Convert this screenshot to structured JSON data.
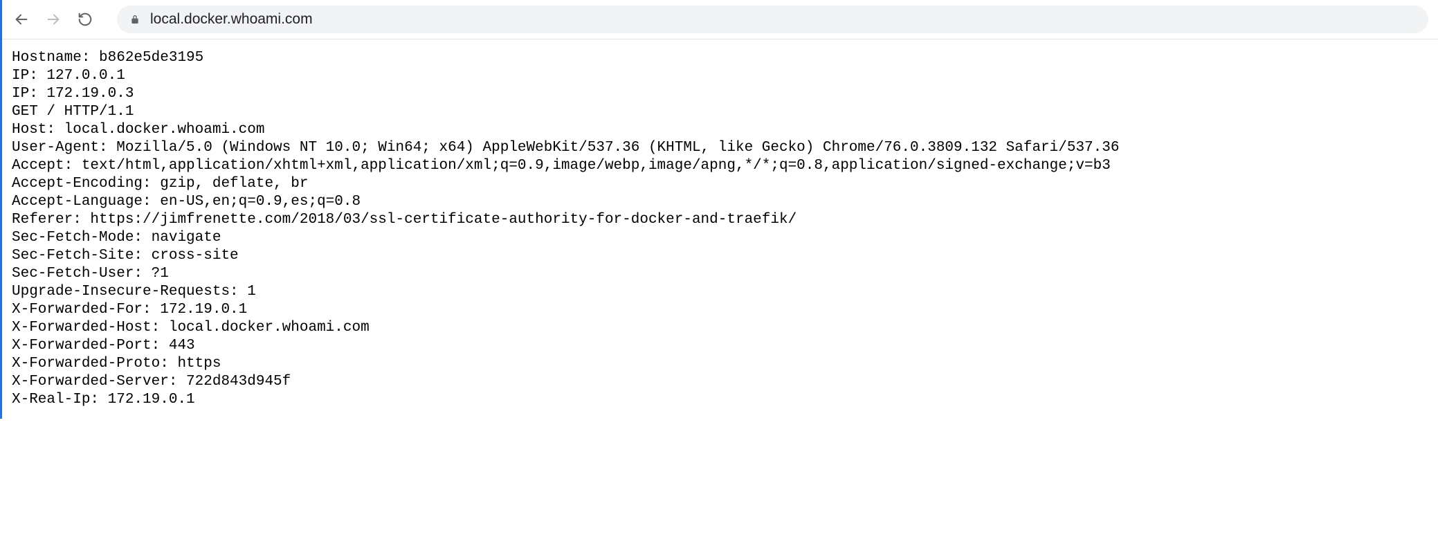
{
  "browser": {
    "url": "local.docker.whoami.com"
  },
  "lines": {
    "l0": "Hostname: b862e5de3195",
    "l1": "IP: 127.0.0.1",
    "l2": "IP: 172.19.0.3",
    "l3": "GET / HTTP/1.1",
    "l4": "Host: local.docker.whoami.com",
    "l5": "User-Agent: Mozilla/5.0 (Windows NT 10.0; Win64; x64) AppleWebKit/537.36 (KHTML, like Gecko) Chrome/76.0.3809.132 Safari/537.36",
    "l6": "Accept: text/html,application/xhtml+xml,application/xml;q=0.9,image/webp,image/apng,*/*;q=0.8,application/signed-exchange;v=b3",
    "l7": "Accept-Encoding: gzip, deflate, br",
    "l8": "Accept-Language: en-US,en;q=0.9,es;q=0.8",
    "l9": "Referer: https://jimfrenette.com/2018/03/ssl-certificate-authority-for-docker-and-traefik/",
    "l10": "Sec-Fetch-Mode: navigate",
    "l11": "Sec-Fetch-Site: cross-site",
    "l12": "Sec-Fetch-User: ?1",
    "l13": "Upgrade-Insecure-Requests: 1",
    "l14": "X-Forwarded-For: 172.19.0.1",
    "l15": "X-Forwarded-Host: local.docker.whoami.com",
    "l16": "X-Forwarded-Port: 443",
    "l17": "X-Forwarded-Proto: https",
    "l18": "X-Forwarded-Server: 722d843d945f",
    "l19": "X-Real-Ip: 172.19.0.1"
  }
}
